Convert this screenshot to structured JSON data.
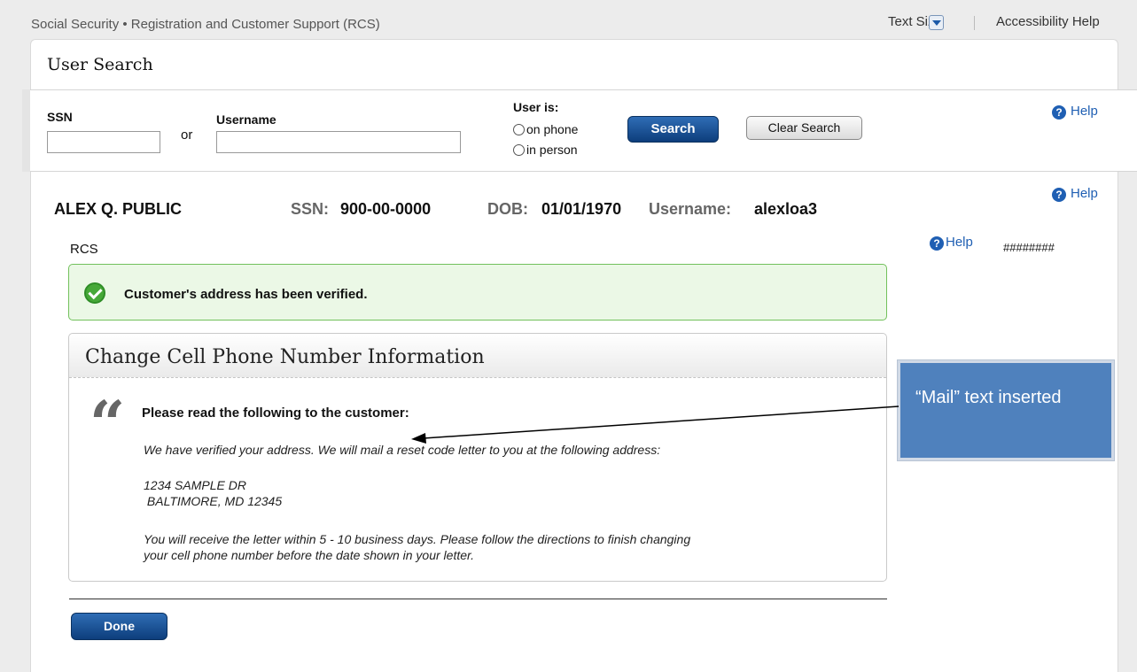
{
  "header": {
    "app_title": "Social Security • Registration and Customer Support (RCS)",
    "text_size_label": "Text Size",
    "accessibility_help": "Accessibility Help"
  },
  "user_search": {
    "title": "User Search",
    "ssn_label": "SSN",
    "or_label": "or",
    "username_label": "Username",
    "ssn_value": "",
    "username_value": "",
    "user_is_label": "User is:",
    "options": [
      "on phone",
      "in person"
    ],
    "search_button": "Search",
    "clear_button": "Clear Search",
    "help": "Help"
  },
  "customer": {
    "name": "ALEX Q. PUBLIC",
    "ssn_label": "SSN:",
    "ssn": "900-00-0000",
    "dob_label": "DOB:",
    "dob": "01/01/1970",
    "username_label": "Username:",
    "username": "alexloa3",
    "help": "Help",
    "section_label": "RCS",
    "section_help": "Help",
    "code": "########"
  },
  "success_message": "Customer's address has been verified.",
  "panel": {
    "title": "Change Cell Phone Number Information",
    "instruction": "Please read the following to the customer:",
    "paragraph1": "We have verified your address. We will mail a reset code letter to you at the following address:",
    "address_line1": "1234 SAMPLE DR",
    "address_line2": " BALTIMORE, MD 12345",
    "paragraph2_line1": "You will receive the letter within 5 - 10 business days.  Please follow the directions to finish changing",
    "paragraph2_line2": "your cell phone number before the date shown in your letter."
  },
  "done_button": "Done",
  "annotation": {
    "text": "“Mail” text inserted",
    "color": "#4f81bd"
  }
}
